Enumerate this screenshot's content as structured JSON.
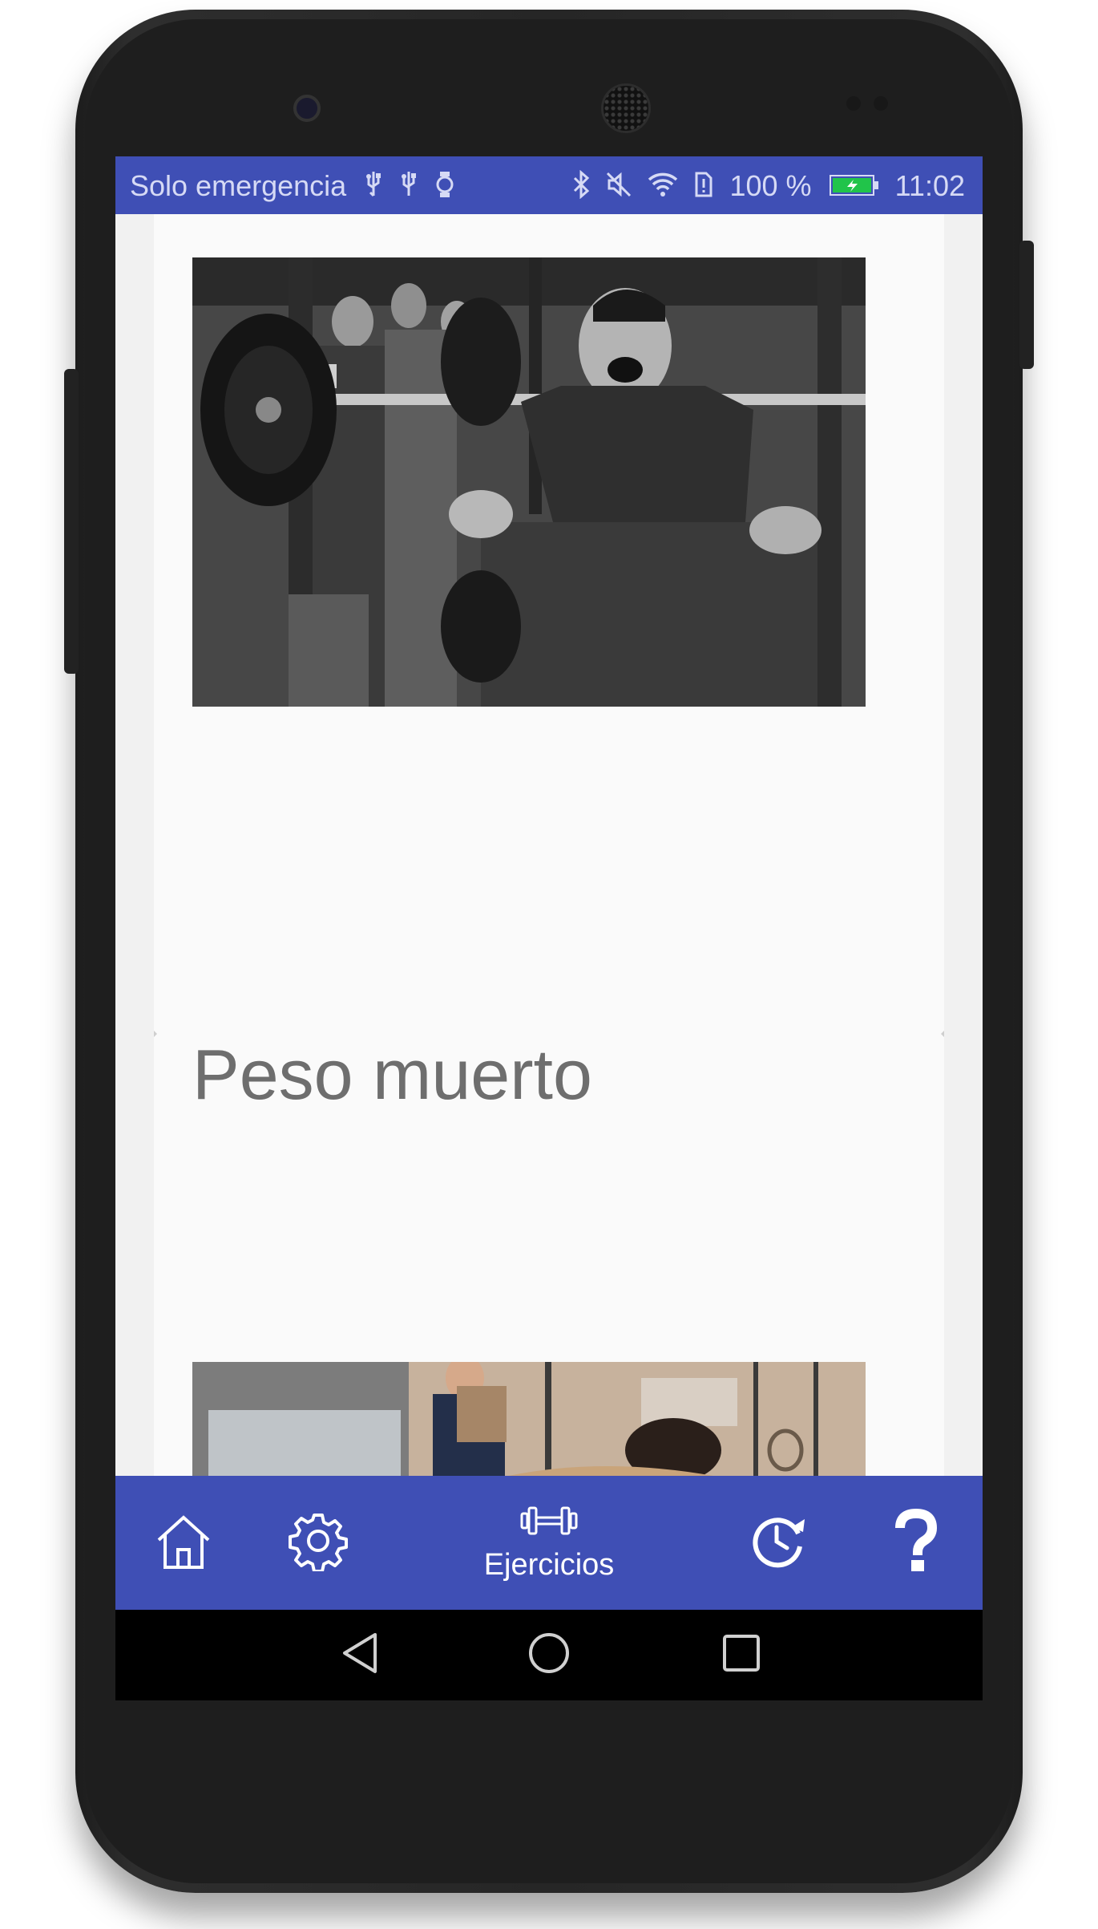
{
  "status_bar": {
    "carrier": "Solo emergencia",
    "battery_percent": "100 %",
    "time": "11:02",
    "left_icons": [
      "usb-icon",
      "usb-icon",
      "watch-icon"
    ],
    "right_icons": [
      "bluetooth-icon",
      "mute-icon",
      "wifi-icon",
      "sim-icon",
      "battery-icon"
    ]
  },
  "exercise_list": {
    "items": [
      {
        "image": "squat-photo",
        "title": ""
      },
      {
        "image": "deadlift-photo",
        "title": "Peso muerto"
      }
    ]
  },
  "bottom_nav": {
    "items": [
      {
        "icon": "home-icon",
        "label": ""
      },
      {
        "icon": "gear-icon",
        "label": ""
      },
      {
        "icon": "dumbbell-icon",
        "label": "Ejercicios",
        "active": true
      },
      {
        "icon": "history-icon",
        "label": ""
      },
      {
        "icon": "help-icon",
        "label": ""
      }
    ]
  },
  "system_nav": [
    "back-icon",
    "home-circle-icon",
    "recents-icon"
  ],
  "colors": {
    "primary": "#3f4fb5",
    "title_text": "#6e6e6e",
    "card": "#fafafa",
    "background": "#f1f1f1"
  }
}
